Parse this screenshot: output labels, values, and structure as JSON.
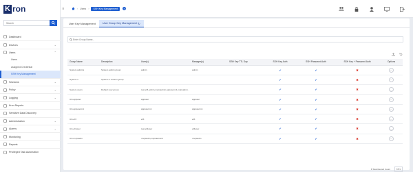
{
  "app": {
    "logo_mark": "K",
    "logo_text": "ron"
  },
  "search": {
    "placeholder": "Search"
  },
  "sidebar": {
    "items": [
      {
        "label": "Dashboard",
        "icon": "dashboard-icon"
      },
      {
        "label": "Devices",
        "icon": "devices-icon",
        "expandable": true
      },
      {
        "label": "Users",
        "icon": "users-icon",
        "expandable": true,
        "expanded": true
      },
      {
        "label": "Sessions",
        "icon": "sessions-icon",
        "expandable": true
      },
      {
        "label": "Policy",
        "icon": "policy-icon",
        "expandable": true
      },
      {
        "label": "Logging",
        "icon": "logging-icon",
        "expandable": true
      },
      {
        "label": "Kron Reports",
        "icon": "reports-icon"
      },
      {
        "label": "Sensitive Data Discovery",
        "icon": "discovery-icon"
      },
      {
        "label": "Administration",
        "icon": "admin-icon",
        "expandable": true
      },
      {
        "label": "Alarms",
        "icon": "alarm-icon",
        "expandable": true
      },
      {
        "label": "Monitoring",
        "icon": "monitor-icon"
      },
      {
        "label": "Reports",
        "icon": "report-icon"
      },
      {
        "label": "Privileged Task Automation",
        "icon": "automation-icon"
      }
    ],
    "users_sub": [
      "Users",
      "assigned Credential",
      "SSH Key Management"
    ]
  },
  "breadcrumb": {
    "items": [
      "Users",
      "SSH Key Management"
    ],
    "help": "?"
  },
  "tabs": [
    "User Key Management",
    "User Group Key Management"
  ],
  "group_search": {
    "placeholder": "Enter Group Name..."
  },
  "table": {
    "headers": [
      "Group Name",
      "Description",
      "User(s)",
      "Manager(s)",
      "SSH Key TTL Day",
      "SSH Key Auth",
      "SSH Password Auth",
      "SSH Key + Password Auth",
      "Options"
    ],
    "rows": [
      {
        "name": "System.admins",
        "desc": "System admin group",
        "users": "admin",
        "managers": "admin",
        "ttl": "",
        "key": true,
        "pwd": true,
        "both": false
      },
      {
        "name": "System.1",
        "desc": "System.1 custom group",
        "users": "",
        "managers": "",
        "ttl": "",
        "key": true,
        "pwd": true,
        "both": false
      },
      {
        "name": "System.users",
        "desc": "Default user group",
        "users": "test,ef3,admin,mvpsadmin,appuserm1,mvpsadmi...",
        "managers": "",
        "ttl": "",
        "key": true,
        "pwd": true,
        "both": false
      },
      {
        "name": "UG.appuser",
        "desc": "",
        "users": "appuser",
        "managers": "appuser",
        "ttl": "",
        "key": true,
        "pwd": true,
        "both": false
      },
      {
        "name": "UG.appuserm1",
        "desc": "",
        "users": "appuserm1",
        "managers": "appuserm1",
        "ttl": "",
        "key": true,
        "pwd": true,
        "both": false
      },
      {
        "name": "UG.ef3",
        "desc": "",
        "users": "ef3",
        "managers": "ef3",
        "ttl": "",
        "key": true,
        "pwd": true,
        "both": false
      },
      {
        "name": "UG.ef4user",
        "desc": "",
        "users": "test,ef4user",
        "managers": "ef4user",
        "ttl": "",
        "key": true,
        "pwd": true,
        "both": false
      },
      {
        "name": "UG.mvpsadm",
        "desc": "",
        "users": "mvpsadm,mvpsadmin2",
        "managers": "mvpsadm",
        "ttl": "",
        "key": true,
        "pwd": true,
        "both": false
      }
    ],
    "footer": {
      "total_label": "8 Total Record Count",
      "page_size": "10 ▾"
    }
  },
  "colors": {
    "accent": "#1f5fd1",
    "check": "#1f5fd1",
    "cross": "#d9362b",
    "logo": "#1a2f6b"
  }
}
